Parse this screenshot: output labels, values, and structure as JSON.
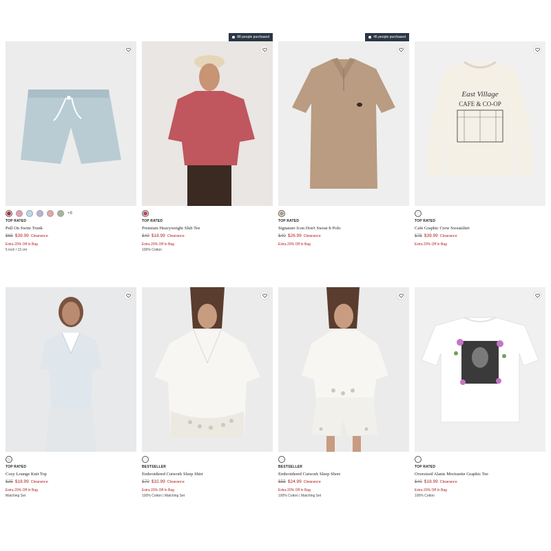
{
  "products": [
    {
      "badge": "",
      "tag": "TOP RATED",
      "name": "Pull On Swim Trunk",
      "original_price": "$65",
      "sale_price": "$39.99",
      "sale_label": "Clearance",
      "promo": "Extra 20% Off In Bag",
      "detail": "5 inch / 13 cm",
      "more_colors": "+8",
      "swatches": [
        "#a83238",
        "#e99bb0",
        "#b9dbe8",
        "#b9b3d6",
        "#e9a5a0",
        "#a7b59a"
      ],
      "image_bg": "#ececec",
      "icon": "swim-trunk"
    },
    {
      "badge": "88 people purchased",
      "tag": "TOP RATED",
      "name": "Premium Heavyweight Slub Tee",
      "original_price": "$40",
      "sale_price": "$18.99",
      "sale_label": "Clearance",
      "promo": "Extra 20% Off In Bag",
      "detail": "100% Cotton",
      "more_colors": "",
      "swatches": [
        "#b94756"
      ],
      "image_bg": "#e9e6e3",
      "icon": "tee-red"
    },
    {
      "badge": "45 people purchased",
      "tag": "TOP RATED",
      "name": "Signature Icon Don't Sweat It Polo",
      "original_price": "$40",
      "sale_price": "$26.99",
      "sale_label": "Clearance",
      "promo": "Extra 20% Off In Bag",
      "detail": "",
      "more_colors": "",
      "swatches": [
        "#b49a7d"
      ],
      "image_bg": "#eeeeee",
      "icon": "polo"
    },
    {
      "badge": "",
      "tag": "TOP RATED",
      "name": "Cafe Graphic Crew Sweatshirt",
      "original_price": "$75",
      "sale_price": "$39.99",
      "sale_label": "Clearance",
      "promo": "Extra 20% Off In Bag",
      "detail": "",
      "more_colors": "",
      "swatches": [
        "#f3efe4"
      ],
      "image_bg": "#f0f0f0",
      "icon": "sweatshirt",
      "graphic_text_1": "East Village",
      "graphic_text_2": "CAFE & CO-OP"
    },
    {
      "badge": "",
      "tag": "TOP RATED",
      "name": "Cozy Lounge Knit Top",
      "original_price": "$35",
      "sale_price": "$18.99",
      "sale_label": "Clearance",
      "promo": "Extra 20% Off In Bag",
      "detail": "Matching Set",
      "more_colors": "",
      "swatches": [
        "#dfe6ec"
      ],
      "image_bg": "#e8e9ea",
      "icon": "lounge-top"
    },
    {
      "badge": "",
      "tag": "BESTSELLER",
      "name": "Embroidered Cutwork Sleep Shirt",
      "original_price": "$70",
      "sale_price": "$32.99",
      "sale_label": "Clearance",
      "promo": "Extra 20% Off In Bag",
      "detail": "100% Cotton | Matching Set",
      "more_colors": "",
      "swatches": [
        "#f6f6f6"
      ],
      "image_bg": "#ebebeb",
      "icon": "sleep-shirt"
    },
    {
      "badge": "",
      "tag": "BESTSELLER",
      "name": "Embroidered Cutwork Sleep Short",
      "original_price": "$55",
      "sale_price": "$24.99",
      "sale_label": "Clearance",
      "promo": "Extra 20% Off In Bag",
      "detail": "100% Cotton | Matching Set",
      "more_colors": "",
      "swatches": [
        "#f6f6f6"
      ],
      "image_bg": "#ebebeb",
      "icon": "sleep-short"
    },
    {
      "badge": "",
      "tag": "TOP RATED",
      "name": "Oversized Alanis Morissette Graphic Tee",
      "original_price": "$40",
      "sale_price": "$18.99",
      "sale_label": "Clearance",
      "promo": "Extra 20% Off In Bag",
      "detail": "100% Cotton",
      "more_colors": "",
      "swatches": [
        "#f6f6f6"
      ],
      "image_bg": "#f0f0f0",
      "icon": "graphic-tee"
    }
  ]
}
